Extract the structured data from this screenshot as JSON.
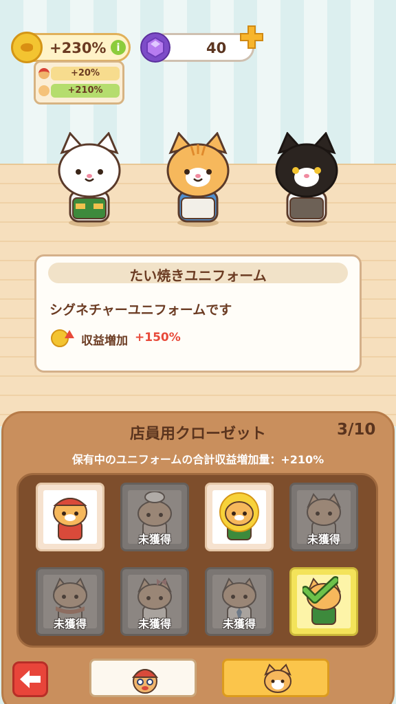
{
  "hud": {
    "coin_bonus": "+230%",
    "info_icon": "i",
    "bonus_breakdown": [
      {
        "icon": "staff-face-icon",
        "value": "+20%"
      },
      {
        "icon": "cat-face-icon",
        "value": "+210%"
      }
    ],
    "gems": "40",
    "gem_icon": "purple-gem-icon",
    "add_icon": "plus-icon"
  },
  "uniform": {
    "title": "たい焼きユニフォーム",
    "description": "シグネチャーユニフォームです",
    "effect_label": "収益増加",
    "effect_value": "+150%"
  },
  "closet": {
    "title": "店員用クローゼット",
    "count": "3/10",
    "total_bonus": "保有中のユニフォームの合計収益増加量：+210%",
    "locked_label": "未獲得",
    "slots": [
      {
        "state": "owned",
        "outfit": "red-cap-uniform"
      },
      {
        "state": "locked",
        "outfit": "chef-hat-uniform"
      },
      {
        "state": "owned",
        "outfit": "sunflower-uniform"
      },
      {
        "state": "locked",
        "outfit": "apron-uniform"
      },
      {
        "state": "locked",
        "outfit": "red-scarf-uniform"
      },
      {
        "state": "locked",
        "outfit": "ribbon-uniform"
      },
      {
        "state": "locked",
        "outfit": "tie-uniform"
      },
      {
        "state": "selected",
        "outfit": "taiyaki-uniform"
      }
    ]
  },
  "colors": {
    "accent_red": "#e84a3a",
    "panel_brown": "#c98f5d",
    "selected_yellow": "#f3e35a"
  }
}
